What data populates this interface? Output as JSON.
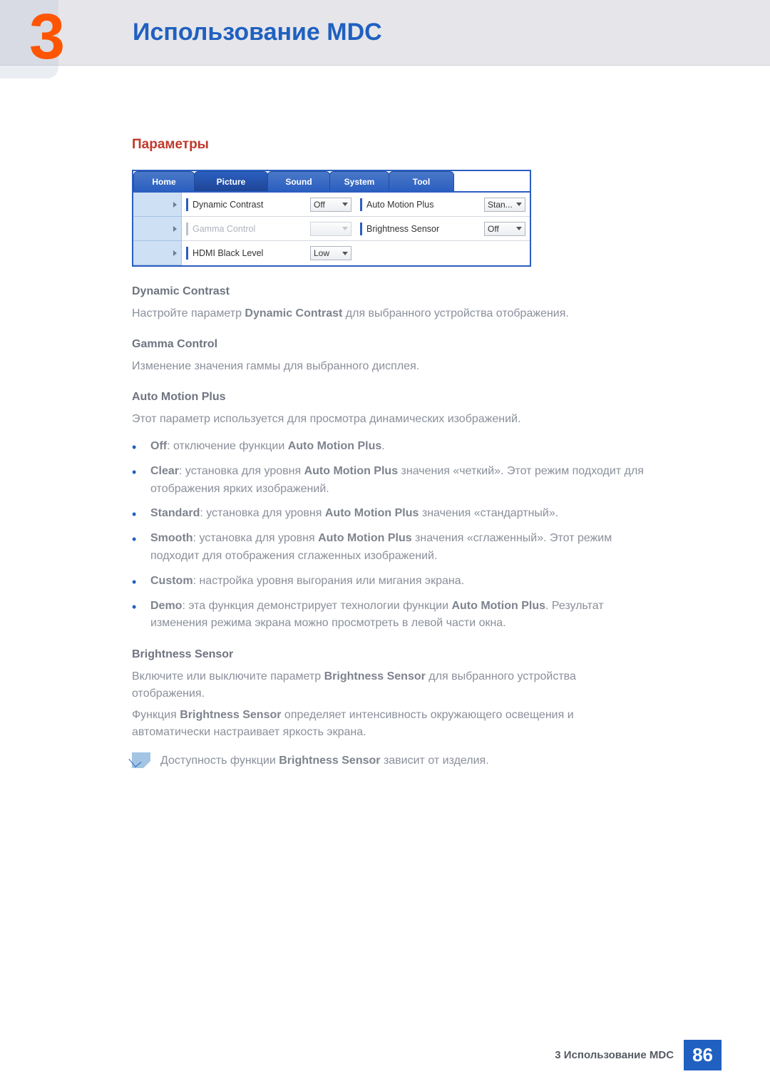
{
  "chapter": {
    "number": "3",
    "title": "Использование MDC"
  },
  "section_title": "Параметры",
  "app": {
    "tabs": [
      "Home",
      "Picture",
      "Sound",
      "System",
      "Tool"
    ],
    "rows": [
      {
        "left_label": "Dynamic Contrast",
        "left_value": "Off",
        "left_disabled": false,
        "right_label": "Auto Motion Plus",
        "right_value": "Stan...",
        "right_disabled": false
      },
      {
        "left_label": "Gamma Control",
        "left_value": "",
        "left_disabled": true,
        "right_label": "Brightness Sensor",
        "right_value": "Off",
        "right_disabled": false
      },
      {
        "left_label": "HDMI Black Level",
        "left_value": "Low",
        "left_disabled": false,
        "right_label": "",
        "right_value": "",
        "right_disabled": true
      }
    ]
  },
  "sections": {
    "dyn_contrast": {
      "title": "Dynamic Contrast",
      "p1_a": "Настройте параметр ",
      "p1_b": "Dynamic Contrast",
      "p1_c": " для выбранного устройства отображения."
    },
    "gamma": {
      "title": "Gamma Control",
      "p1": "Изменение значения гаммы для выбранного дисплея."
    },
    "amp": {
      "title": "Auto Motion Plus",
      "p1": "Этот параметр используется для просмотра динамических изображений.",
      "bullets": [
        {
          "b": "Off",
          "t": ": отключение функции ",
          "b2": "Auto Motion Plus",
          "t2": "."
        },
        {
          "b": "Clear",
          "t": ": установка для уровня ",
          "b2": "Auto Motion Plus",
          "t2": " значения «четкий». Этот режим подходит для отображения ярких изображений."
        },
        {
          "b": "Standard",
          "t": ": установка для уровня ",
          "b2": "Auto Motion Plus",
          "t2": " значения «стандартный»."
        },
        {
          "b": "Smooth",
          "t": ": установка для уровня ",
          "b2": "Auto Motion Plus",
          "t2": " значения «сглаженный». Этот режим подходит для отображения сглаженных изображений."
        },
        {
          "b": "Custom",
          "t": ": настройка уровня выгорания или мигания экрана.",
          "b2": "",
          "t2": ""
        },
        {
          "b": "Demo",
          "t": ": эта функция демонстрирует технологии функции ",
          "b2": "Auto Motion Plus",
          "t2": ". Результат изменения режима экрана можно просмотреть в левой части окна."
        }
      ]
    },
    "bs": {
      "title": "Brightness Sensor",
      "p1_a": "Включите или выключите параметр ",
      "p1_b": "Brightness Sensor",
      "p1_c": " для выбранного устройства отображения.",
      "p2_a": "Функция ",
      "p2_b": "Brightness Sensor",
      "p2_c": " определяет интенсивность окружающего освещения и автоматически настраивает яркость экрана.",
      "note_a": "Доступность функции ",
      "note_b": "Brightness Sensor",
      "note_c": " зависит от изделия."
    }
  },
  "footer": {
    "text": "3 Использование MDC",
    "page": "86"
  }
}
